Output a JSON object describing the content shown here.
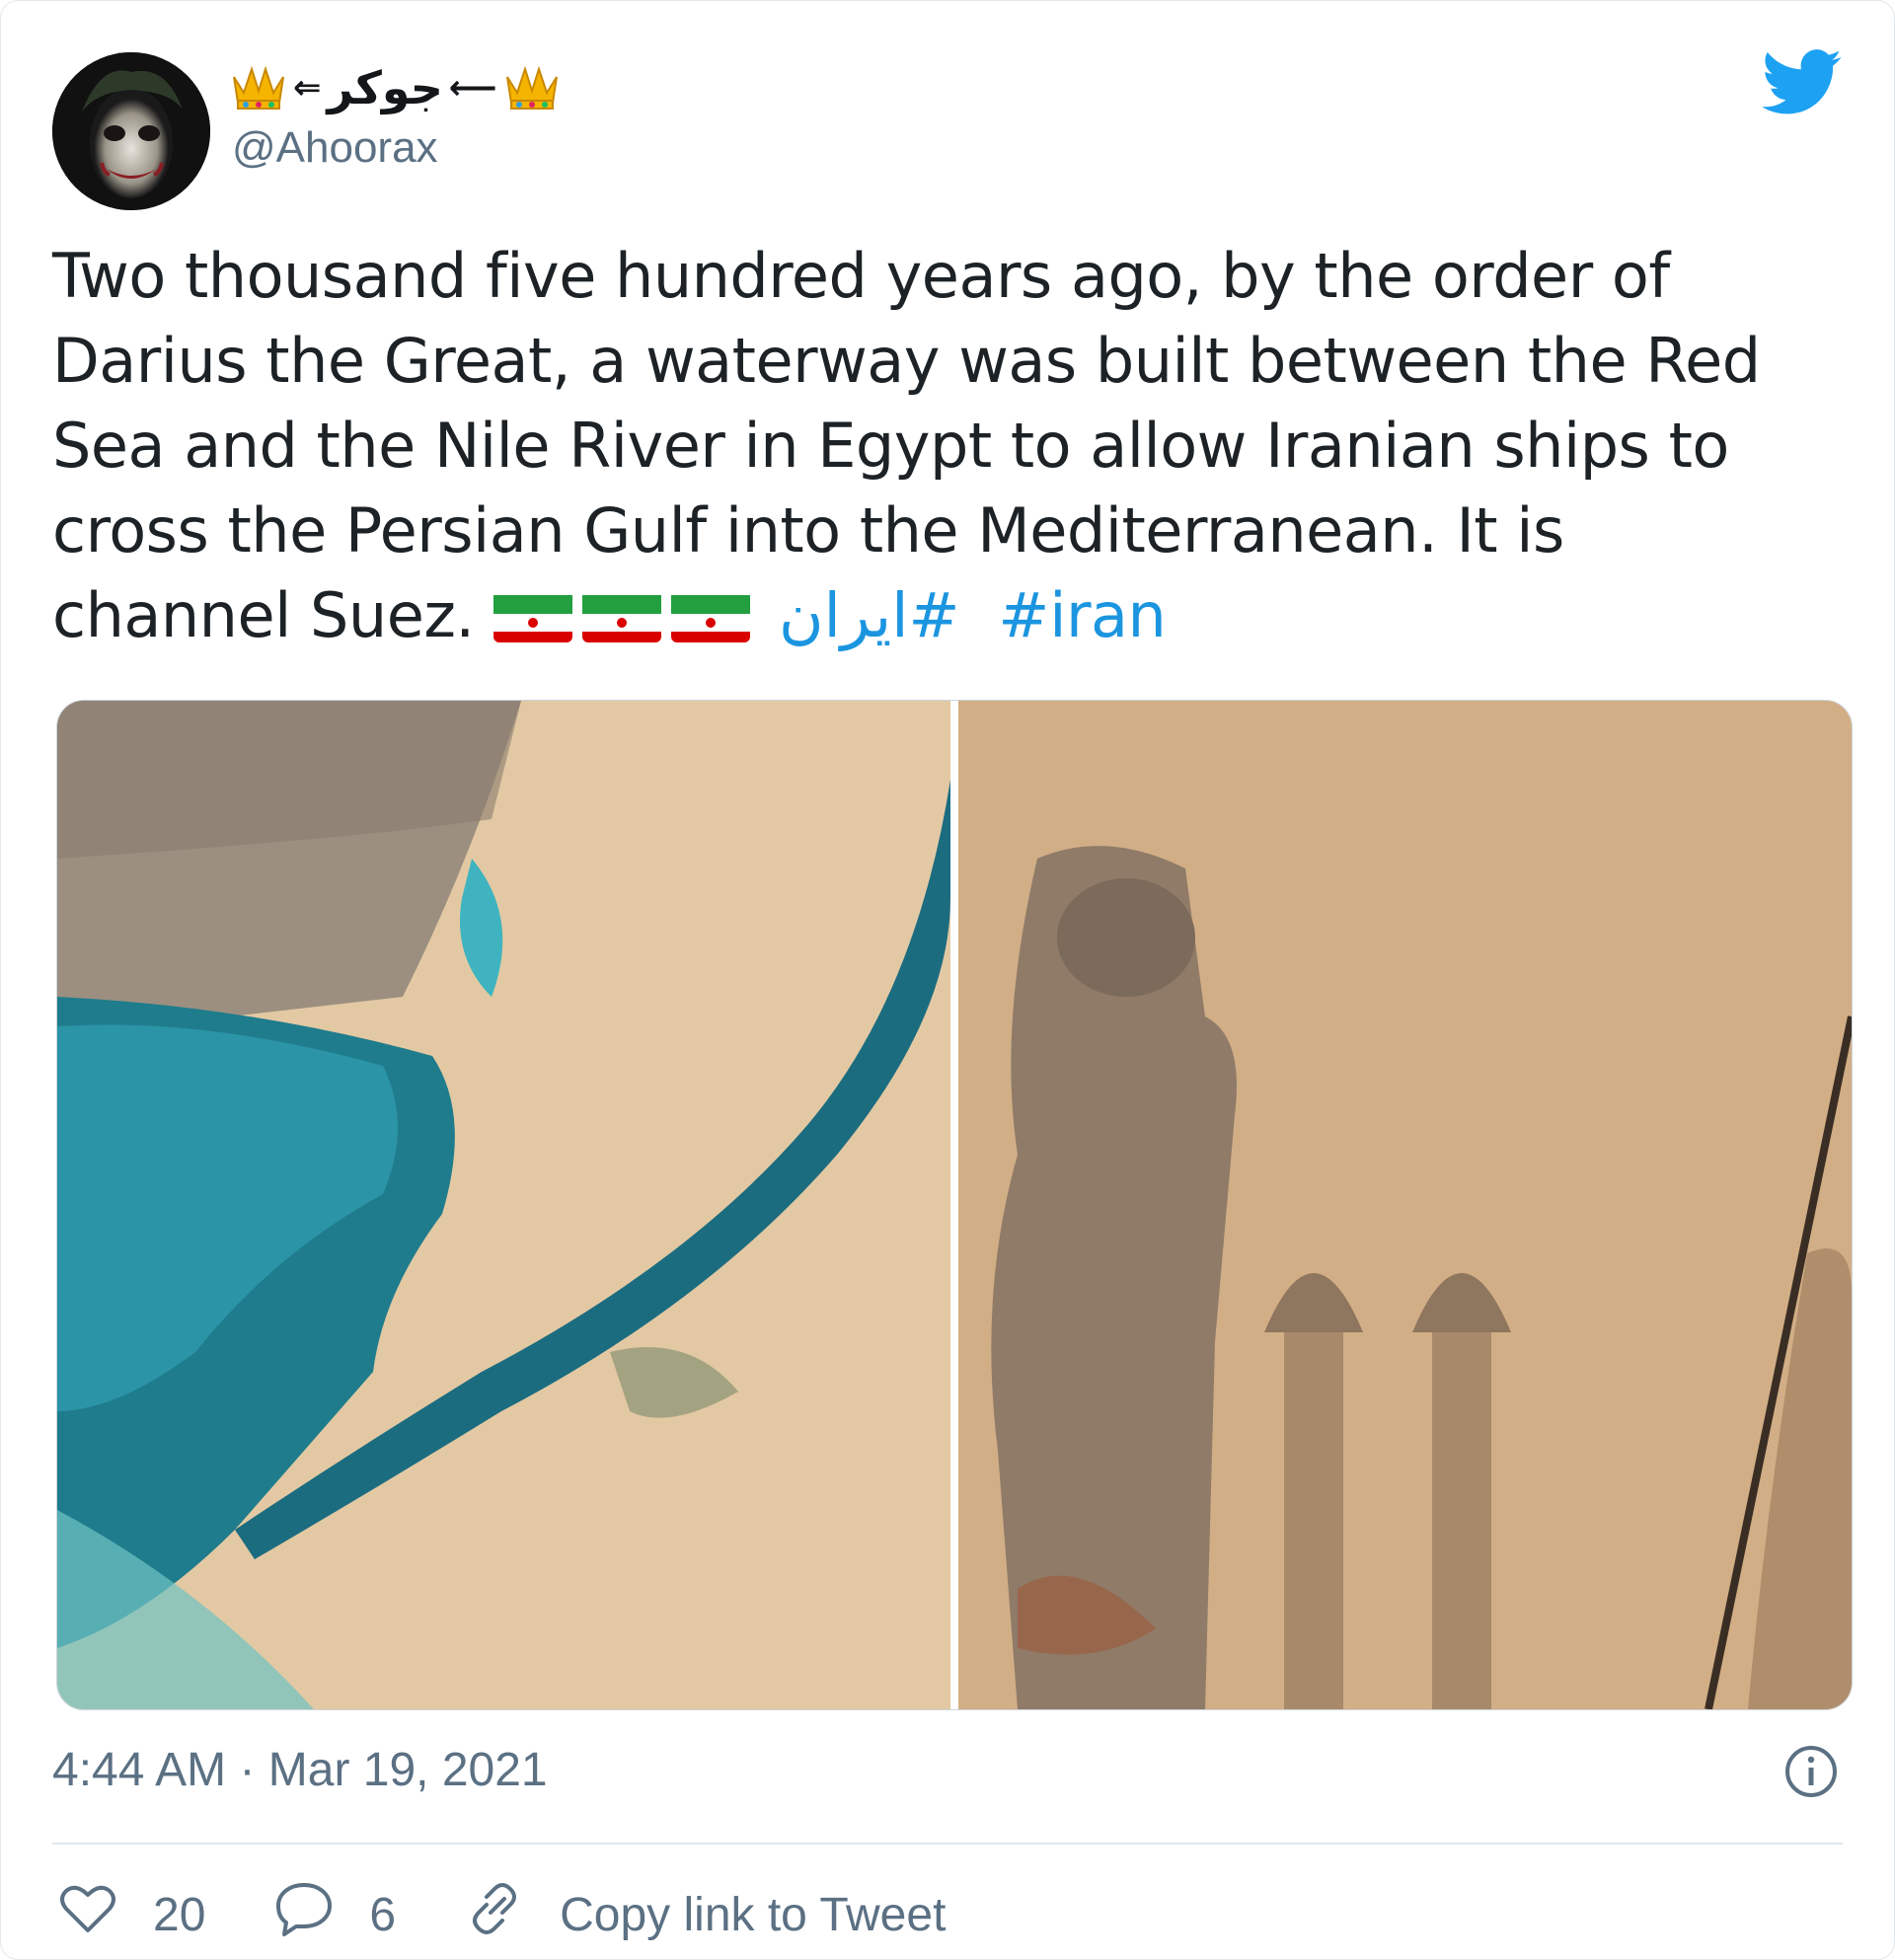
{
  "user": {
    "display_name": "جوکر",
    "handle": "@Ahoorax",
    "avatar_icon": "joker-avatar"
  },
  "tweet": {
    "lines": [
      "Two thousand five hundred years ago, by the order of",
      "Darius the Great, a waterway was built between the Red",
      "Sea and the Nile River in Egypt to allow Iranian ships to",
      "cross the Persian Gulf into the Mediterranean.  It is",
      "channel Suez."
    ],
    "flag_icon": "iran-flag-emoji",
    "hashtags": [
      "#ایران",
      "#iran"
    ]
  },
  "media": [
    {
      "name": "satellite-photo-suez",
      "description_icon": "aerial-image"
    },
    {
      "name": "persepolis-relief-photo",
      "description_icon": "relief-image"
    }
  ],
  "timestamp": "4:44 AM · Mar 19, 2021",
  "actions": {
    "likes": "20",
    "replies": "6",
    "copy_link": "Copy link to Tweet"
  },
  "colors": {
    "link": "#1b95e0",
    "twitter_blue": "#1da1f2",
    "muted": "#5b7083",
    "text": "#1c2226"
  }
}
